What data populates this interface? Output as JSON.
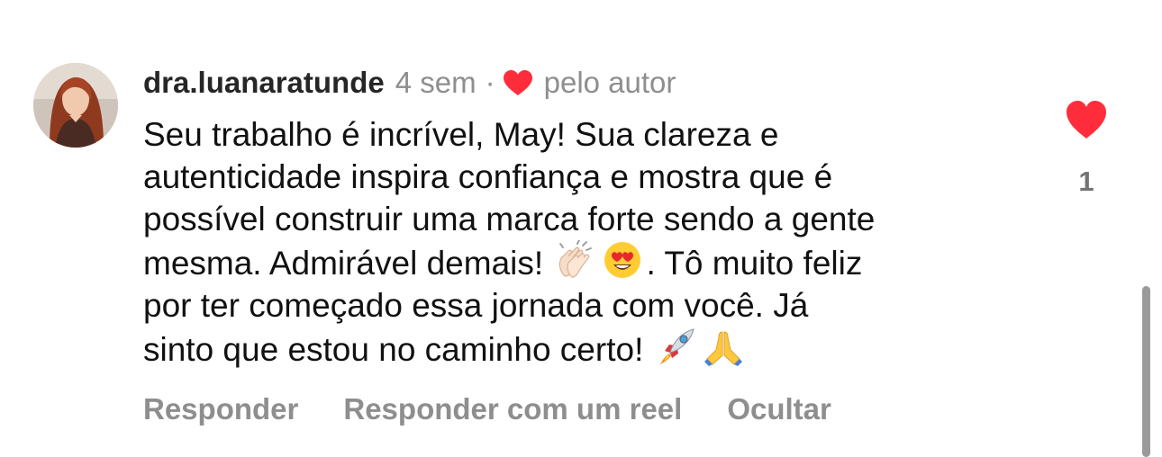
{
  "comment": {
    "username": "dra.luanaratunde",
    "time_ago": "4 sem",
    "separator": "·",
    "liked_by_author_label": "pelo autor",
    "text_lines": [
      "Seu trabalho é incrível, May! Sua clareza e",
      "autenticidade inspira confiança e mostra que é",
      "possível construir uma marca forte sendo a gente",
      "mesma. Admirável demais!",
      ". Tô muito feliz",
      "por ter começado essa jornada com você. Já",
      "sinto que estou no caminho certo!"
    ],
    "emojis": [
      "clapping-hands-emoji",
      "heart-eyes-emoji",
      "rocket-emoji",
      "folded-hands-emoji"
    ],
    "like_count": "1",
    "actions": {
      "reply": "Responder",
      "reply_with_reel": "Responder com um reel",
      "hide": "Ocultar"
    }
  },
  "colors": {
    "like_red": "#ff2d3c",
    "muted_text": "#8e8e8e",
    "username": "#262626"
  }
}
